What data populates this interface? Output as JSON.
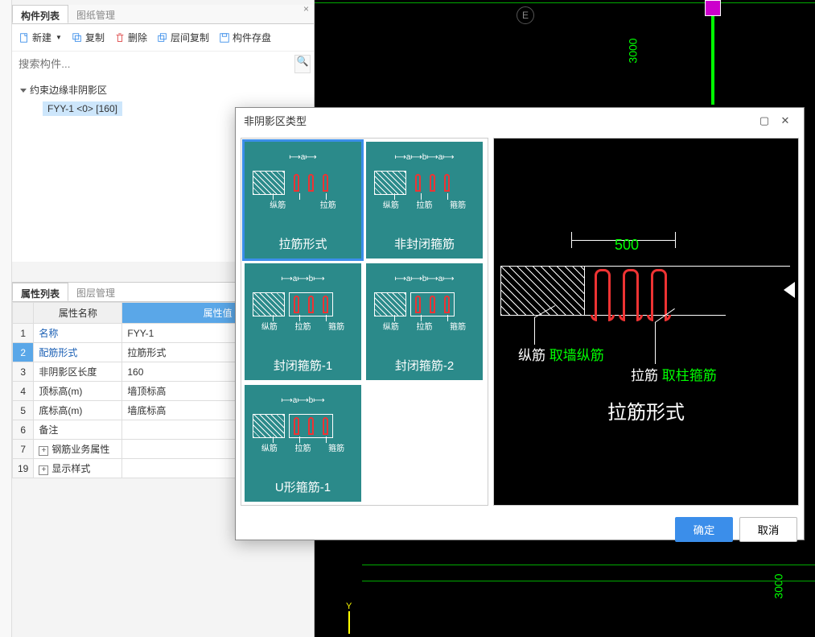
{
  "left": {
    "tabs": [
      "构件列表",
      "图纸管理"
    ],
    "toolbar": {
      "new": "新建",
      "copy": "复制",
      "delete": "删除",
      "floorcopy": "层间复制",
      "save": "构件存盘"
    },
    "searchPlaceholder": "搜索构件...",
    "treeRoot": "约束边缘非阴影区",
    "treeChild": "FYY-1 <0> [160]"
  },
  "props": {
    "tabs": [
      "属性列表",
      "图层管理"
    ],
    "headName": "属性名称",
    "headValue": "属性值",
    "rows": [
      {
        "i": "1",
        "n": "名称",
        "v": "FYY-1",
        "blue": true
      },
      {
        "i": "2",
        "n": "配筋形式",
        "v": "拉筋形式",
        "blue": true,
        "sel": true
      },
      {
        "i": "3",
        "n": "非阴影区长度",
        "v": "160"
      },
      {
        "i": "4",
        "n": "顶标高(m)",
        "v": "墙顶标高"
      },
      {
        "i": "5",
        "n": "底标高(m)",
        "v": "墙底标高"
      },
      {
        "i": "6",
        "n": "备注",
        "v": ""
      },
      {
        "i": "7",
        "n": "钢筋业务属性",
        "v": "",
        "plus": true
      },
      {
        "i": "19",
        "n": "显示样式",
        "v": "",
        "plus": true
      }
    ]
  },
  "modal": {
    "title": "非阴影区类型",
    "thumbs": [
      {
        "label": "拉筋形式",
        "anno": [
          "纵筋",
          "拉筋"
        ],
        "dim": "a",
        "sel": true,
        "border": false
      },
      {
        "label": "非封闭箍筋",
        "anno": [
          "纵筋",
          "拉筋",
          "箍筋"
        ],
        "dim": "a b a",
        "border": false
      },
      {
        "label": "封闭箍筋-1",
        "anno": [
          "纵筋",
          "拉筋",
          "箍筋"
        ],
        "dim": "a b",
        "border": true
      },
      {
        "label": "封闭箍筋-2",
        "anno": [
          "纵筋",
          "拉筋",
          "箍筋"
        ],
        "dim": "a b a",
        "border": true
      },
      {
        "label": "U形箍筋-1",
        "anno": [
          "纵筋",
          "拉筋",
          "箍筋"
        ],
        "dim": "a b",
        "border": true
      }
    ],
    "preview": {
      "dim": "500",
      "a1": "纵筋",
      "a1g": "取墙纵筋",
      "a2": "拉筋",
      "a2g": "取柱箍筋",
      "title": "拉筋形式"
    },
    "ok": "确定",
    "cancel": "取消"
  },
  "canvas": {
    "letter": "E",
    "dim": "3000",
    "Y": "Y"
  }
}
